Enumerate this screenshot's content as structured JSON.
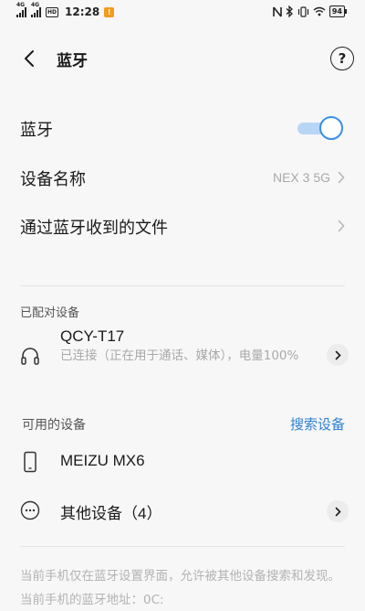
{
  "status_bar": {
    "signal_1": "4G",
    "signal_2": "4G",
    "hd": "HD",
    "time": "12:28",
    "notification": "!",
    "battery": "94"
  },
  "header": {
    "title": "蓝牙",
    "help": "?"
  },
  "settings": {
    "bluetooth_label": "蓝牙",
    "bluetooth_enabled": true,
    "device_name_label": "设备名称",
    "device_name_value": "NEX 3 5G",
    "received_files_label": "通过蓝牙收到的文件"
  },
  "paired": {
    "title": "已配对设备",
    "devices": [
      {
        "name": "QCY-T17",
        "status": "已连接（正在用于通话、媒体），电量100%",
        "icon": "headphones-icon"
      }
    ]
  },
  "available": {
    "title": "可用的设备",
    "search_label": "搜索设备",
    "devices": [
      {
        "name": "MEIZU MX6",
        "icon": "phone-icon"
      },
      {
        "name": "其他设备（4）",
        "icon": "more-icon"
      }
    ]
  },
  "footer": {
    "note": "当前手机仅在蓝牙设置界面，允许被其他设备搜索和发现。当前手机的蓝牙地址：0C:"
  },
  "colors": {
    "accent": "#3a8ee8",
    "link": "#2f80d6",
    "secondary_text": "#a9a9a9"
  }
}
